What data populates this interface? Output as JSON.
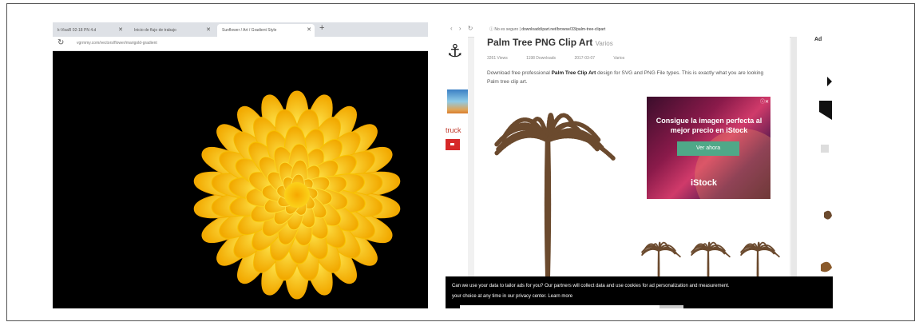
{
  "left_browser": {
    "tabs": [
      {
        "label": "k-VisaR 02-18 PN 4.d"
      },
      {
        "label": "Inicio de flujo de trabajo"
      },
      {
        "label": "Sunflower / Art / Gradient Style"
      }
    ],
    "url": "vgrmmy.com/vectors/flower/marigold-gradient"
  },
  "right_browser": {
    "url_prefix": "No es seguro",
    "url": "downloadclipart.net/browse/33/palm-tree-clipart",
    "sidebar_left": {
      "truck_label": "truck"
    },
    "page": {
      "title": "Palm Tree PNG Clip Art",
      "title_suffix": "Varios",
      "meta": [
        "3261 Views",
        "1198 Downloads",
        "2017-03-07",
        "Varios"
      ],
      "description_pre": "Download free professional ",
      "description_bold": "Palm Tree Clip Art",
      "description_post": " design for SVG and PNG File types. This is exactly what you are looking Palm tree clip art."
    },
    "ad": {
      "headline": "Consigue la imagen perfecta al mejor precio en iStock",
      "button": "Ver ahora",
      "logo": "iStock"
    },
    "sidebar_right": {
      "label": "Ad"
    },
    "cookie_banner": {
      "line1": "Can we use your data to tailor ads for you? Our partners will collect data and use cookies for ad personalization and measurement.",
      "line2": "your choice at any time in our privacy center. Learn more"
    }
  },
  "colors": {
    "flower_outer": "#f5b400",
    "flower_inner": "#fde24a",
    "palm_brown": "#6b4a2e",
    "ad_button": "#4fa888"
  }
}
